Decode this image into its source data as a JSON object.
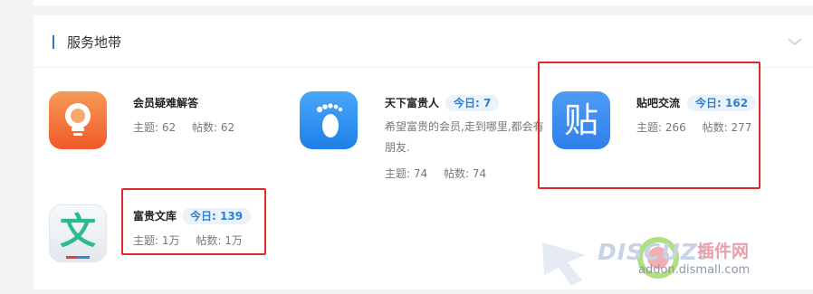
{
  "section": {
    "title": "服务地带"
  },
  "forums": [
    {
      "name": "会员疑难解答",
      "today": "",
      "topics_label": "主题:",
      "topics": "62",
      "posts_label": "帖数:",
      "posts": "62",
      "icon": "lightbulb-icon",
      "icon_color": "#f26b35"
    },
    {
      "name": "天下富贵人",
      "today_label": "今日:",
      "today": "7",
      "description": "希望富贵的会员,走到哪里,都会有朋友.",
      "topics_label": "主题:",
      "topics": "74",
      "posts_label": "帖数:",
      "posts": "74",
      "icon": "footprint-icon",
      "icon_color": "#2a8df0"
    },
    {
      "name": "贴吧交流",
      "today_label": "今日:",
      "today": "162",
      "topics_label": "主题:",
      "topics": "266",
      "posts_label": "帖数:",
      "posts": "277",
      "icon": "tieba-icon",
      "icon_glyph": "贴",
      "icon_color": "#3b8cf2"
    },
    {
      "name": "富贵文库",
      "today_label": "今日:",
      "today": "139",
      "topics_label": "主题:",
      "topics": "1万",
      "posts_label": "帖数:",
      "posts": "1万",
      "icon": "wenku-icon",
      "icon_glyph": "文",
      "icon_color": "#2bbb8e"
    }
  ],
  "watermark": {
    "brand": "DISCUZ!",
    "cn": "插件网",
    "url": "addon.dismall.com"
  },
  "colors": {
    "accent": "#2b7acb",
    "highlight_box": "#e0282b"
  }
}
